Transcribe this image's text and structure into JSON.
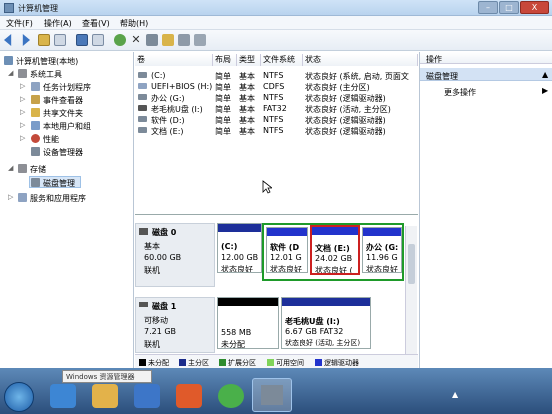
{
  "window": {
    "title": "计算机管理",
    "buttons": [
      "–",
      "□",
      "X"
    ]
  },
  "menu": [
    "文件(F)",
    "操作(A)",
    "查看(V)",
    "帮助(H)"
  ],
  "tree": {
    "root": "计算机管理(本地)",
    "system_tools": "系统工具",
    "items": [
      "任务计划程序",
      "事件查看器",
      "共享文件夹",
      "本地用户和组",
      "性能",
      "设备管理器"
    ],
    "storage": "存储",
    "disk_mgmt": "磁盘管理",
    "services": "服务和应用程序"
  },
  "list": {
    "headers": [
      "卷",
      "布局",
      "类型",
      "文件系统",
      "状态"
    ],
    "rows": [
      [
        "(C:)",
        "简单",
        "基本",
        "NTFS",
        "状态良好 (系统, 启动, 页面文"
      ],
      [
        "UEFI+BIOS (H:)",
        "简单",
        "基本",
        "CDFS",
        "状态良好 (主分区)"
      ],
      [
        "办公 (G:)",
        "简单",
        "基本",
        "NTFS",
        "状态良好 (逻辑驱动器)"
      ],
      [
        "老毛桃U盘 (I:)",
        "简单",
        "基本",
        "FAT32",
        "状态良好 (活动, 主分区)"
      ],
      [
        "软件 (D:)",
        "简单",
        "基本",
        "NTFS",
        "状态良好 (逻辑驱动器)"
      ],
      [
        "文档 (E:)",
        "简单",
        "基本",
        "NTFS",
        "状态良好 (逻辑驱动器)"
      ]
    ]
  },
  "disks": [
    {
      "name": "磁盘 0",
      "type": "基本",
      "size": "60.00 GB",
      "status": "联机",
      "partitions": [
        {
          "name": "(C:)",
          "size": "12.00 GB",
          "status": "状态良好"
        },
        {
          "name": "软件 (D",
          "size": "12.01 G",
          "status": "状态良好"
        },
        {
          "name": "文档 (E:)",
          "size": "24.02 GB",
          "status": "状态良好 ("
        },
        {
          "name": "办公 (G:",
          "size": "11.96 G",
          "status": "状态良好"
        }
      ]
    },
    {
      "name": "磁盘 1",
      "type": "可移动",
      "size": "7.21 GB",
      "status": "联机",
      "partitions": [
        {
          "name": "",
          "size": "558 MB",
          "status": "未分配"
        },
        {
          "name": "老毛桃U盘 (I:)",
          "size": "6.67 GB FAT32",
          "status": "状态良好 (活动, 主分区)"
        }
      ]
    }
  ],
  "legend": [
    {
      "label": "未分配",
      "color": "#000000"
    },
    {
      "label": "主分区",
      "color": "#1a2b8a"
    },
    {
      "label": "扩展分区",
      "color": "#2e8b2e"
    },
    {
      "label": "可用空间",
      "color": "#7fd35a"
    },
    {
      "label": "逻辑驱动器",
      "color": "#2233cc"
    }
  ],
  "actions": {
    "header": "操作",
    "section": "磁盘管理",
    "more": "更多操作"
  },
  "taskbar": {
    "tooltip": "Windows 资源管理器"
  },
  "colors": {
    "partition_bar": "#1d2f9a",
    "highlight_green": "#1e9a2a",
    "highlight_red": "#cc2020"
  }
}
